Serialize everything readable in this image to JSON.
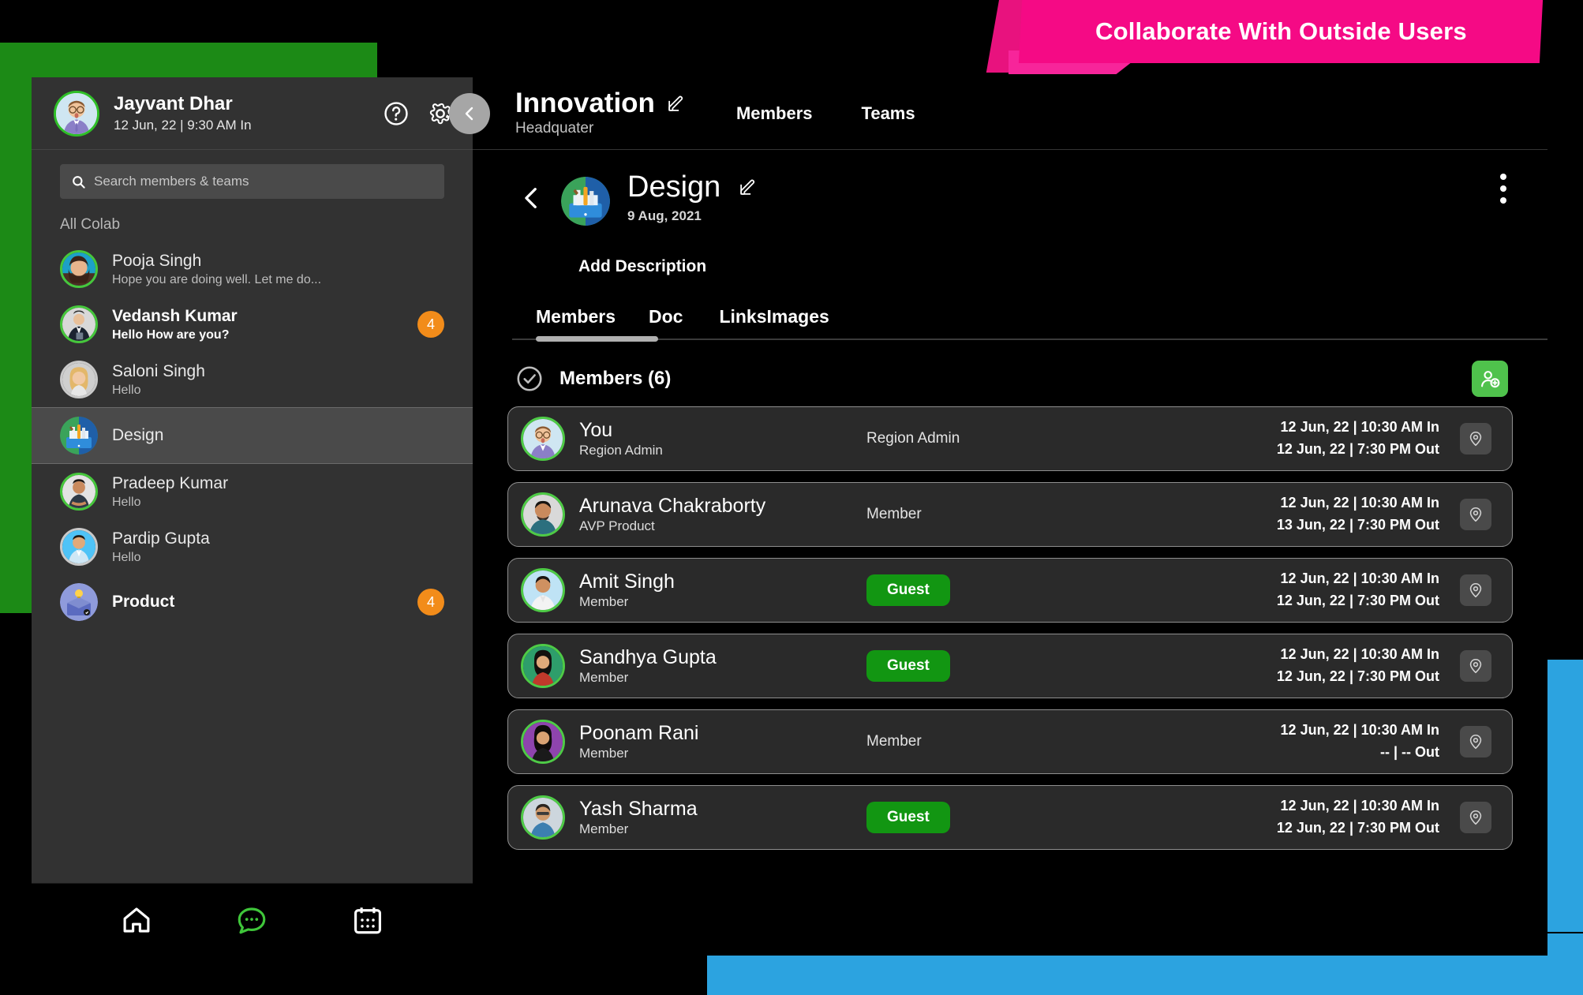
{
  "banner": {
    "text": "Collaborate With Outside Users",
    "bg_color": "#F50A85",
    "text_color": "#FFFFFF"
  },
  "sidebar": {
    "user": {
      "name": "Jayvant Dhar",
      "status": "12 Jun, 22 | 9:30 AM In"
    },
    "help_icon": "help-circle-icon",
    "settings_icon": "gear-icon",
    "collapse_icon": "chevron-left-icon",
    "search": {
      "value": "",
      "placeholder": "Search members & teams",
      "icon": "search-icon"
    },
    "section_label": "All Colab",
    "items": [
      {
        "title": "Pooja Singh",
        "subtitle": "Hope you are doing well. Let me do...",
        "badge": "",
        "unread": false,
        "type": "person"
      },
      {
        "title": "Vedansh Kumar",
        "subtitle": "Hello How are you?",
        "badge": "4",
        "unread": true,
        "type": "person"
      },
      {
        "title": "Saloni Singh",
        "subtitle": "Hello",
        "badge": "",
        "unread": false,
        "type": "person"
      },
      {
        "title": "Design",
        "subtitle": "",
        "badge": "",
        "unread": false,
        "type": "team",
        "selected": true
      },
      {
        "title": "Pradeep Kumar",
        "subtitle": "Hello",
        "badge": "",
        "unread": false,
        "type": "person"
      },
      {
        "title": "Pardip Gupta",
        "subtitle": "Hello",
        "badge": "",
        "unread": false,
        "type": "person"
      },
      {
        "title": "Product",
        "subtitle": "",
        "badge": "4",
        "unread": true,
        "type": "team"
      }
    ],
    "bottom_nav": [
      {
        "icon": "home-icon",
        "active": false
      },
      {
        "icon": "chat-bubble-icon",
        "active": true
      },
      {
        "icon": "calendar-icon",
        "active": false
      }
    ]
  },
  "header": {
    "org_title": "Innovation",
    "org_subtitle": "Headquater",
    "edit_icon": "edit-pencil-icon",
    "nav": [
      {
        "label": "Members"
      },
      {
        "label": "Teams"
      }
    ]
  },
  "group": {
    "back_icon": "chevron-left-icon",
    "avatar_icon": "design-team-icon",
    "title": "Design",
    "date": "9 Aug, 2021",
    "edit_icon": "edit-pencil-icon",
    "menu_icon": "kebab-menu-icon",
    "add_description": "Add Description"
  },
  "tabs": [
    {
      "label": "Members",
      "active": true
    },
    {
      "label": "Doc",
      "active": false
    },
    {
      "label": "Links",
      "active": false
    },
    {
      "label": "Images",
      "active": false
    }
  ],
  "members_section": {
    "check_icon": "check-circle-icon",
    "title": "Members (6)",
    "add_member_icon": "add-person-icon",
    "add_member_color": "#4FC24C",
    "guest_badge_color": "#129612",
    "rows": [
      {
        "name": "You",
        "subtitle": "Region Admin",
        "role": "Region Admin",
        "role_is_badge": false,
        "time_in": "12 Jun, 22 |  10:30 AM In",
        "time_out": "12 Jun, 22 |  7:30 PM Out",
        "pin_icon": "location-pin-icon"
      },
      {
        "name": "Arunava Chakraborty",
        "subtitle": "AVP Product",
        "role": "Member",
        "role_is_badge": false,
        "time_in": "12 Jun, 22 |  10:30 AM In",
        "time_out": "13 Jun, 22 |  7:30 PM Out",
        "pin_icon": "location-pin-icon"
      },
      {
        "name": "Amit Singh",
        "subtitle": "Member",
        "role": "Guest",
        "role_is_badge": true,
        "time_in": "12 Jun, 22 |  10:30 AM In",
        "time_out": "12 Jun, 22 |  7:30 PM Out",
        "pin_icon": "location-pin-icon"
      },
      {
        "name": "Sandhya Gupta",
        "subtitle": "Member",
        "role": "Guest",
        "role_is_badge": true,
        "time_in": "12 Jun, 22 |  10:30 AM In",
        "time_out": "12 Jun, 22 |  7:30 PM Out",
        "pin_icon": "location-pin-icon"
      },
      {
        "name": "Poonam Rani",
        "subtitle": "Member",
        "role": "Member",
        "role_is_badge": false,
        "time_in": "12 Jun, 22 |  10:30 AM In",
        "time_out": "-- |  -- Out",
        "pin_icon": "location-pin-icon"
      },
      {
        "name": "Yash Sharma",
        "subtitle": "Member",
        "role": "Guest",
        "role_is_badge": true,
        "time_in": "12 Jun, 22 |  10:30 AM In",
        "time_out": "12 Jun, 22 |  7:30 PM Out",
        "pin_icon": "location-pin-icon"
      }
    ]
  },
  "decor": {
    "green": "#1C8A16",
    "blue": "#2CA3E0"
  }
}
